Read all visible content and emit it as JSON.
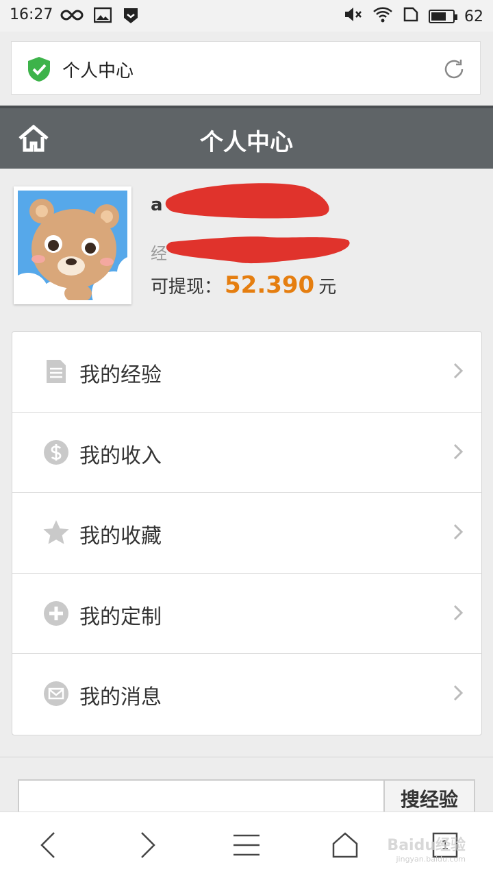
{
  "status_bar": {
    "time": "16:27",
    "battery_level": "62",
    "icons": [
      "infinity-icon",
      "image-icon",
      "shield-app-icon",
      "mute-icon",
      "wifi-icon",
      "sim-icon",
      "battery-icon"
    ]
  },
  "url_bar": {
    "title": "个人中心",
    "secure_icon": "green-shield-check-icon",
    "refresh_icon": "refresh-icon"
  },
  "header": {
    "title": "个人中心",
    "home_icon": "home-icon"
  },
  "profile": {
    "name_visible": "a",
    "exp_prefix": "经",
    "withdraw_label": "可提现：",
    "withdraw_amount": "52.390",
    "withdraw_unit": "元",
    "accent_color": "#e57e10"
  },
  "menu": {
    "items": [
      {
        "label": "我的经验",
        "icon": "document-icon"
      },
      {
        "label": "我的收入",
        "icon": "dollar-icon"
      },
      {
        "label": "我的收藏",
        "icon": "star-icon"
      },
      {
        "label": "我的定制",
        "icon": "plus-circle-icon"
      },
      {
        "label": "我的消息",
        "icon": "mail-icon"
      }
    ]
  },
  "search": {
    "placeholder": "",
    "button_label": "搜经验"
  },
  "bottom_nav": {
    "tabs_count": "1",
    "watermark": "Baidu经验",
    "watermark_sub": "jingyan.baidu.com"
  }
}
